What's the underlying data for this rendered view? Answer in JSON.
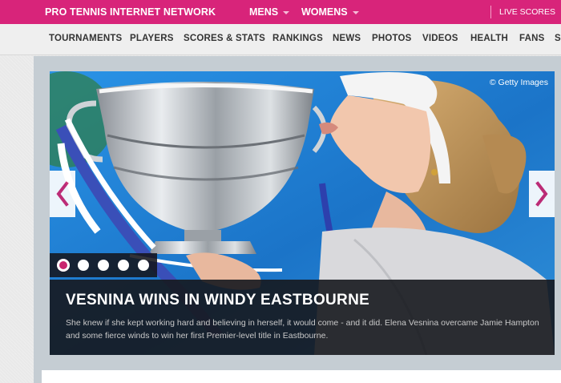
{
  "topbar": {
    "brand": "PRO TENNIS INTERNET NETWORK",
    "mens": "MENS",
    "womens": "WOMENS",
    "live_scores": "LIVE SCORES"
  },
  "subnav": {
    "items": [
      "TOURNAMENTS",
      "PLAYERS",
      "SCORES & STATS",
      "RANKINGS",
      "NEWS",
      "PHOTOS",
      "VIDEOS",
      "HEALTH",
      "FANS",
      "S"
    ]
  },
  "slider": {
    "credit": "© Getty Images",
    "headline": "VESNINA WINS IN WINDY EASTBOURNE",
    "summary": "She knew if she kept working hard and believing in herself, it would come - and it did. Elena Vesnina overcame Jamie Hampton and some fierce winds to win her first Premier-level title in Eastbourne.",
    "slide_count": 5,
    "active_slide": 1
  },
  "colors": {
    "brand": "#d8247a",
    "background": "#e9e9e9",
    "caption_bg": "#16181e"
  }
}
